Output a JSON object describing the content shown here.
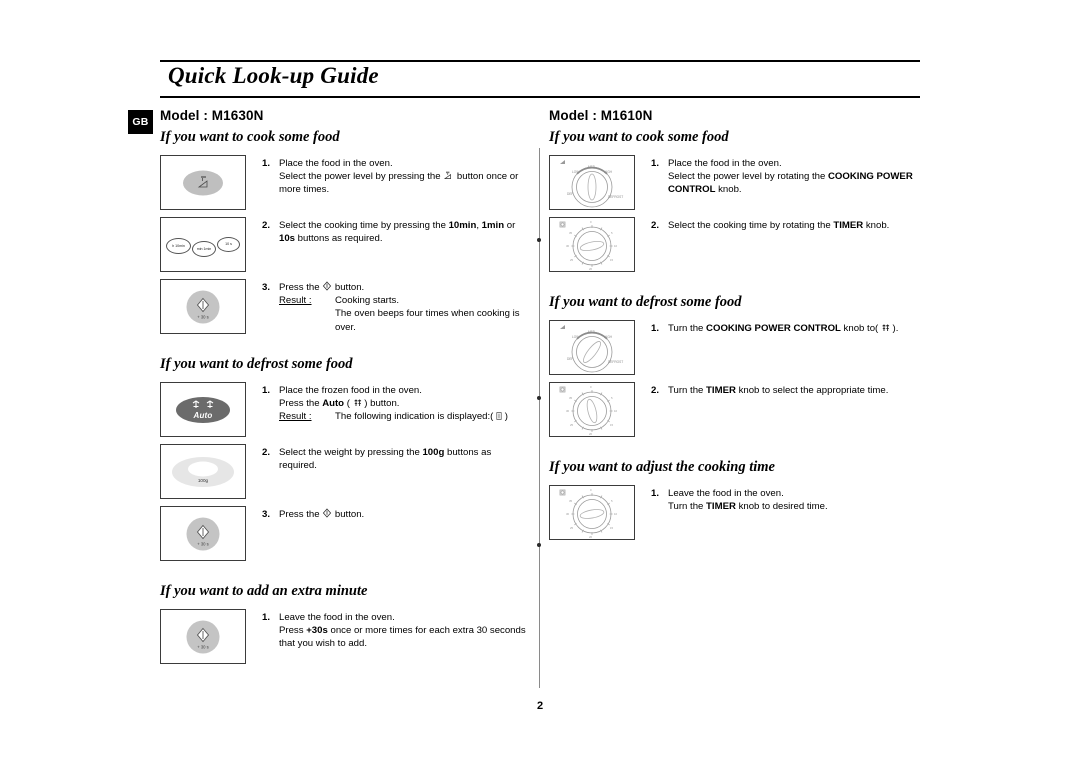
{
  "document": {
    "title": "Quick Look-up Guide",
    "region_badge": "GB",
    "page_number": "2"
  },
  "left_column": {
    "model_title": "Model : M1630N",
    "sections": [
      {
        "heading": "If you want to cook some food",
        "steps": [
          {
            "number": "1.",
            "lines": [
              "Place the food in the oven.",
              "Select the power level by pressing the   button once or more times."
            ],
            "figure": "power-level-button"
          },
          {
            "number": "2.",
            "lines": [
              "Select the cooking time by pressing the 10min, 1min or 10s buttons as required."
            ],
            "figure": "time-buttons",
            "bold_terms": [
              "10min",
              "1min",
              "10s"
            ]
          },
          {
            "number": "3.",
            "lines": [
              "Press the   button."
            ],
            "result_label": "Result :",
            "result_lines": [
              "Cooking starts.",
              "The oven beeps four times when cooking is over."
            ],
            "figure": "start-button"
          }
        ]
      },
      {
        "heading": "If you want to defrost some food",
        "steps": [
          {
            "number": "1.",
            "lines": [
              "Place the frozen food in the oven.",
              "Press the Auto ( ) button."
            ],
            "result_label": "Result :",
            "result_lines": [
              "The following indication is displayed:( )"
            ],
            "figure": "auto-defrost-button",
            "bold_terms": [
              "Auto"
            ]
          },
          {
            "number": "2.",
            "lines": [
              "Select the weight by pressing the 100g buttons as required."
            ],
            "figure": "weight-button",
            "bold_terms": [
              "100g"
            ]
          },
          {
            "number": "3.",
            "lines": [
              "Press the   button."
            ],
            "figure": "start-button"
          }
        ]
      },
      {
        "heading": "If you want to add an extra minute",
        "steps": [
          {
            "number": "1.",
            "lines": [
              "Leave the food in the oven.",
              "Press +30s once or more times for each extra 30 seconds that you wish to add."
            ],
            "figure": "start-button",
            "bold_terms": [
              "+30s"
            ]
          }
        ]
      }
    ]
  },
  "right_column": {
    "model_title": "Model : M1610N",
    "sections": [
      {
        "heading": "If you want to cook some food",
        "steps": [
          {
            "number": "1.",
            "lines": [
              "Place the food in the oven.",
              "Select the power level by rotating the COOKING POWER CONTROL knob."
            ],
            "figure": "power-knob",
            "bold_terms": [
              "COOKING POWER CONTROL"
            ]
          },
          {
            "number": "2.",
            "lines": [
              "Select the cooking time by rotating the TIMER knob."
            ],
            "figure": "timer-knob",
            "bold_terms": [
              "TIMER"
            ]
          }
        ]
      },
      {
        "heading": "If you want to defrost some food",
        "steps": [
          {
            "number": "1.",
            "lines": [
              "Turn the COOKING POWER CONTROL knob to( )."
            ],
            "figure": "power-knob",
            "bold_terms": [
              "COOKING POWER CONTROL"
            ]
          },
          {
            "number": "2.",
            "lines": [
              "Turn the TIMER knob to select the appropriate time."
            ],
            "figure": "timer-knob",
            "bold_terms": [
              "TIMER"
            ]
          }
        ]
      },
      {
        "heading": "If you want to adjust the cooking time",
        "steps": [
          {
            "number": "1.",
            "lines": [
              "Leave the food in the oven.",
              "Turn the TIMER knob to desired time."
            ],
            "figure": "timer-knob",
            "bold_terms": [
              "TIMER"
            ]
          }
        ]
      }
    ]
  },
  "figure_labels": {
    "time_button_1": "h 10min",
    "time_button_2": "min 1min",
    "time_button_3": "10 s",
    "start_button_sub": "+ 30 s",
    "auto_button": "Auto",
    "weight_button": "100g"
  },
  "colors": {
    "text": "#000000",
    "badge_bg": "#000000",
    "badge_text": "#ffffff",
    "figure_border": "#3b3b3b",
    "button_gray": "#bfbfbf",
    "button_dark": "#6b6b6b",
    "divider": "#8a8a8a"
  }
}
